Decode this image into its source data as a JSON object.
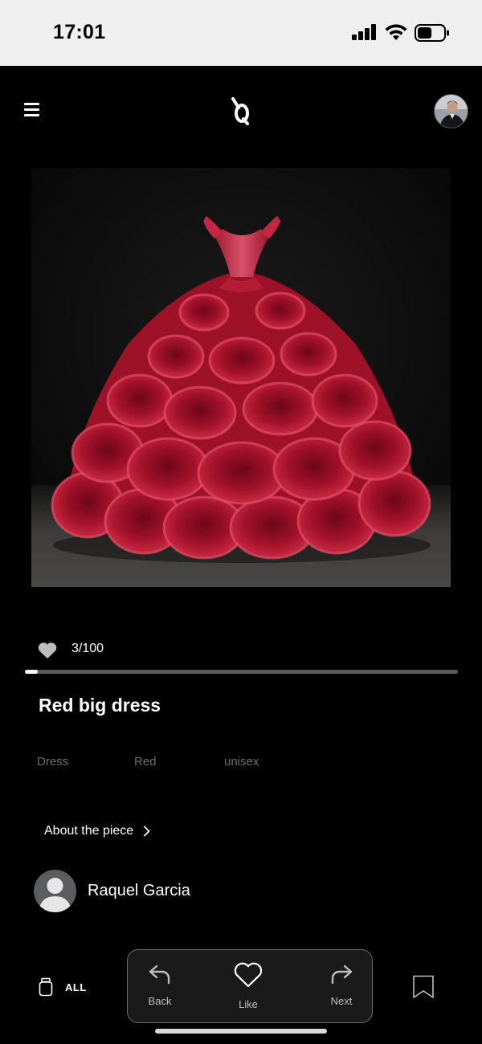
{
  "status_bar": {
    "time": "17:01",
    "signal_icon": "cellular-signal-icon",
    "wifi_icon": "wifi-icon",
    "battery_icon": "battery-icon",
    "battery_level": 0.55
  },
  "header": {
    "menu_icon": "hamburger-menu-icon",
    "logo_icon": "app-logo-icon",
    "avatar": "user-avatar"
  },
  "artwork": {
    "image": "red-ruffled-ball-gown-photo"
  },
  "likes": {
    "icon": "heart-icon",
    "count_text": "3/100",
    "progress": 0.03
  },
  "piece": {
    "title": "Red big dress",
    "tags": [
      "Dress",
      "Red",
      "unisex"
    ],
    "about_label": "About the piece",
    "about_icon": "chevron-right-icon"
  },
  "author": {
    "name": "Raquel Garcia",
    "avatar_icon": "default-person-icon"
  },
  "bottom_bar": {
    "all_label": "ALL",
    "all_icon": "jar-icon",
    "actions": [
      {
        "label": "Back",
        "icon": "undo-arrow-icon"
      },
      {
        "label": "Like",
        "icon": "heart-outline-icon"
      },
      {
        "label": "Next",
        "icon": "redo-arrow-icon"
      }
    ],
    "bookmark_icon": "bookmark-icon"
  },
  "colors": {
    "background": "#000000",
    "status_bar_bg": "#efefef",
    "dress_red": "#c2182f",
    "tag_text": "#6e6e6e",
    "panel_border": "#6a6a6a"
  }
}
